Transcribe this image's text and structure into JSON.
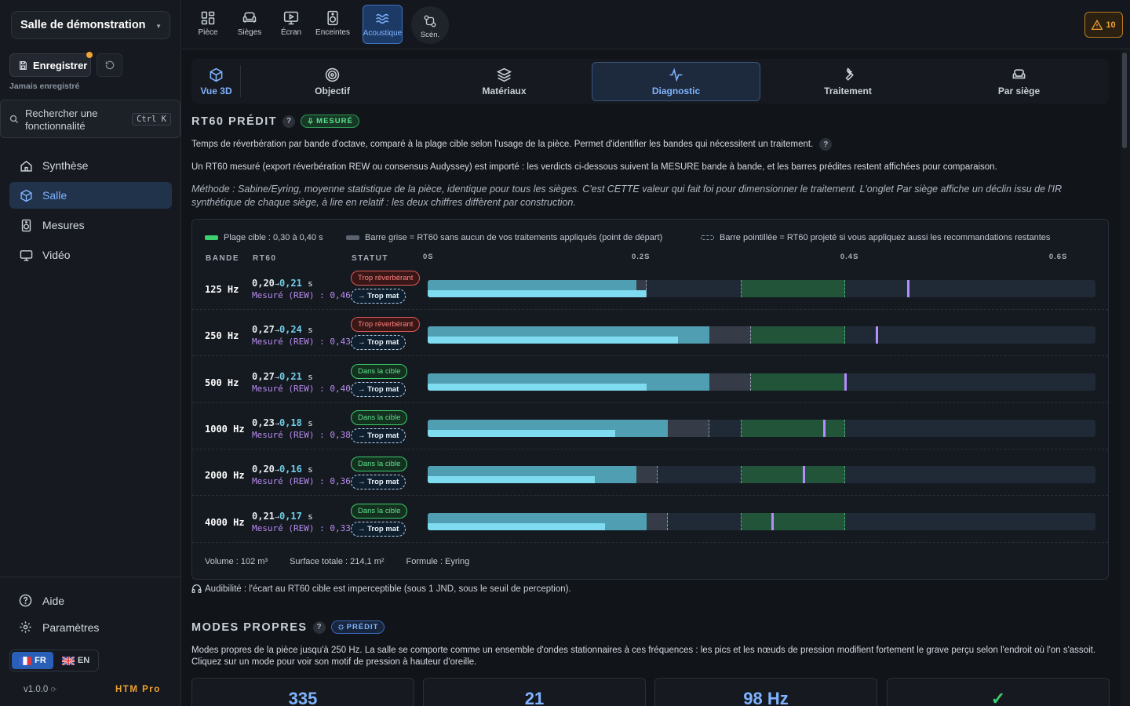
{
  "sidebar": {
    "room_name": "Salle de démonstration",
    "save_label": "Enregistrer",
    "save_status": "Jamais enregistré",
    "search_placeholder": "Rechercher une fonctionnalité",
    "search_shortcut": "Ctrl K",
    "nav": [
      {
        "label": "Synthèse",
        "icon": "home-icon",
        "active": false
      },
      {
        "label": "Salle",
        "icon": "cube-icon",
        "active": true
      },
      {
        "label": "Mesures",
        "icon": "speaker-icon",
        "active": false
      },
      {
        "label": "Vidéo",
        "icon": "monitor-icon",
        "active": false
      }
    ],
    "bottom_nav": [
      {
        "label": "Aide",
        "icon": "help-icon"
      },
      {
        "label": "Paramètres",
        "icon": "gear-icon"
      }
    ],
    "languages": [
      {
        "label": "FR",
        "active": true
      },
      {
        "label": "EN",
        "active": false
      }
    ],
    "version": "v1.0.0",
    "plan": "HTM Pro"
  },
  "toolbar": {
    "tools": [
      {
        "label": "Pièce",
        "icon": "grid-icon"
      },
      {
        "label": "Sièges",
        "icon": "sofa-icon"
      },
      {
        "label": "Écran",
        "icon": "screen-icon"
      },
      {
        "label": "Enceintes",
        "icon": "speaker-icon"
      },
      {
        "label": "Acoustique",
        "icon": "waves-icon",
        "active": true
      },
      {
        "label": "Scén.",
        "icon": "scenario-icon"
      }
    ],
    "warnings_count": "10"
  },
  "subtabs": [
    {
      "label": "Vue 3D",
      "icon": "cube-icon"
    },
    {
      "label": "Objectif",
      "icon": "target-icon"
    },
    {
      "label": "Matériaux",
      "icon": "layers-icon"
    },
    {
      "label": "Diagnostic",
      "icon": "pulse-icon",
      "active": true
    },
    {
      "label": "Traitement",
      "icon": "wrench-icon"
    },
    {
      "label": "Par siège",
      "icon": "armchair-icon"
    }
  ],
  "rt60": {
    "title": "RT60 PRÉDIT",
    "badge": "MESURÉ",
    "description": "Temps de réverbération par bande d'octave, comparé à la plage cible selon l'usage de la pièce. Permet d'identifier les bandes qui nécessitent un traitement.",
    "measured_note": "Un RT60 mesuré (export réverbération REW ou consensus Audyssey) est importé : les verdicts ci-dessous suivent la MESURE bande à bande, et les barres prédites restent affichées pour comparaison.",
    "method": "Méthode : Sabine/Eyring, moyenne statistique de la pièce, identique pour tous les sièges. C'est CETTE valeur qui fait foi pour dimensionner le traitement. L'onglet Par siège affiche un déclin issu de l'IR synthétique de chaque siège, à lire en relatif : les deux chiffres diffèrent par construction.",
    "legend": {
      "target": "Plage cible : 0,30 à 0,40 s",
      "grey": "Barre grise = RT60 sans aucun de vos traitements appliqués (point de départ)",
      "dotted": "Barre pointillée = RT60 projeté si vous appliquez aussi les recommandations restantes"
    },
    "columns": {
      "band": "BANDE",
      "rt60": "RT60",
      "status": "STATUT"
    },
    "ticks": [
      "0S",
      "0.2S",
      "0.4S",
      "0.6S"
    ],
    "scale_max": 0.64,
    "target_range": [
      0.3,
      0.4
    ],
    "arrow": "→",
    "unit": "s",
    "measured_prefix": "Mesuré (REW) : ",
    "bands": [
      {
        "band": "125 Hz",
        "pred": "0,20",
        "proj": "0,21",
        "measured": "0,46",
        "status": "Trop réverbérant",
        "status_type": "over",
        "rec": "→ Trop mat",
        "v_pred": 0.2,
        "v_proj": 0.21,
        "v_base": 0.21,
        "v_meas": 0.46
      },
      {
        "band": "250 Hz",
        "pred": "0,27",
        "proj": "0,24",
        "measured": "0,43",
        "status": "Trop réverbérant",
        "status_type": "over",
        "rec": "→ Trop mat",
        "v_pred": 0.27,
        "v_proj": 0.24,
        "v_base": 0.31,
        "v_meas": 0.43
      },
      {
        "band": "500 Hz",
        "pred": "0,27",
        "proj": "0,21",
        "measured": "0,40",
        "status": "Dans la cible",
        "status_type": "ok",
        "rec": "→ Trop mat",
        "v_pred": 0.27,
        "v_proj": 0.21,
        "v_base": 0.31,
        "v_meas": 0.4
      },
      {
        "band": "1000 Hz",
        "pred": "0,23",
        "proj": "0,18",
        "measured": "0,38",
        "status": "Dans la cible",
        "status_type": "ok",
        "rec": "→ Trop mat",
        "v_pred": 0.23,
        "v_proj": 0.18,
        "v_base": 0.27,
        "v_meas": 0.38
      },
      {
        "band": "2000 Hz",
        "pred": "0,20",
        "proj": "0,16",
        "measured": "0,36",
        "status": "Dans la cible",
        "status_type": "ok",
        "rec": "→ Trop mat",
        "v_pred": 0.2,
        "v_proj": 0.16,
        "v_base": 0.22,
        "v_meas": 0.36
      },
      {
        "band": "4000 Hz",
        "pred": "0,21",
        "proj": "0,17",
        "measured": "0,33",
        "status": "Dans la cible",
        "status_type": "ok",
        "rec": "→ Trop mat",
        "v_pred": 0.21,
        "v_proj": 0.17,
        "v_base": 0.23,
        "v_meas": 0.33
      }
    ],
    "footer": {
      "volume": "Volume : 102 m³",
      "surface": "Surface totale : 214,1 m²",
      "formula": "Formule : Eyring"
    },
    "audibility": "Audibilité : l'écart au RT60 cible est imperceptible (sous 1 JND, sous le seuil de perception)."
  },
  "modes": {
    "title": "MODES PROPRES",
    "badge": "PRÉDIT",
    "description": "Modes propres de la pièce jusqu'à 250 Hz. La salle se comporte comme un ensemble d'ondes stationnaires à ces fréquences : les pics et les nœuds de pression modifient fortement le grave perçu selon l'endroit où l'on s'assoit. Cliquez sur un mode pour voir son motif de pression à hauteur d'oreille.",
    "cards": [
      "335",
      "21",
      "98 Hz",
      "✓"
    ]
  }
}
